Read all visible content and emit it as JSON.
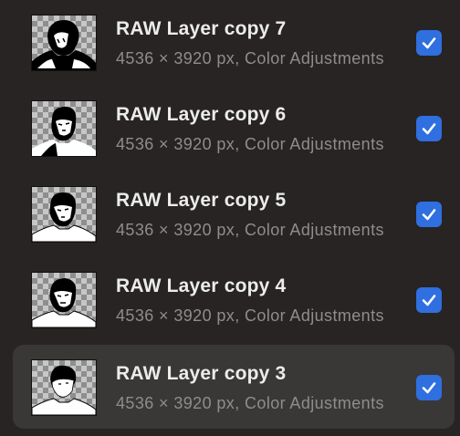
{
  "colors": {
    "background": "#272423",
    "selected_row": "#3a3837",
    "checkbox_accent": "#2f6fe0",
    "title_text": "#ececec",
    "subtitle_text": "#8f8d8b"
  },
  "layers": [
    {
      "name": "RAW Layer copy 7",
      "info": "4536 × 3920 px, Color Adjustments",
      "visible": true,
      "selected": false,
      "thumbnail_icon": "portrait-silhouette-icon"
    },
    {
      "name": "RAW Layer copy 6",
      "info": "4536 × 3920 px, Color Adjustments",
      "visible": true,
      "selected": false,
      "thumbnail_icon": "portrait-silhouette-icon"
    },
    {
      "name": "RAW Layer copy 5",
      "info": "4536 × 3920 px, Color Adjustments",
      "visible": true,
      "selected": false,
      "thumbnail_icon": "portrait-silhouette-icon"
    },
    {
      "name": "RAW Layer copy 4",
      "info": "4536 × 3920 px, Color Adjustments",
      "visible": true,
      "selected": false,
      "thumbnail_icon": "portrait-silhouette-icon"
    },
    {
      "name": "RAW Layer copy 3",
      "info": "4536 × 3920 px, Color Adjustments",
      "visible": true,
      "selected": true,
      "thumbnail_icon": "portrait-silhouette-icon"
    }
  ]
}
